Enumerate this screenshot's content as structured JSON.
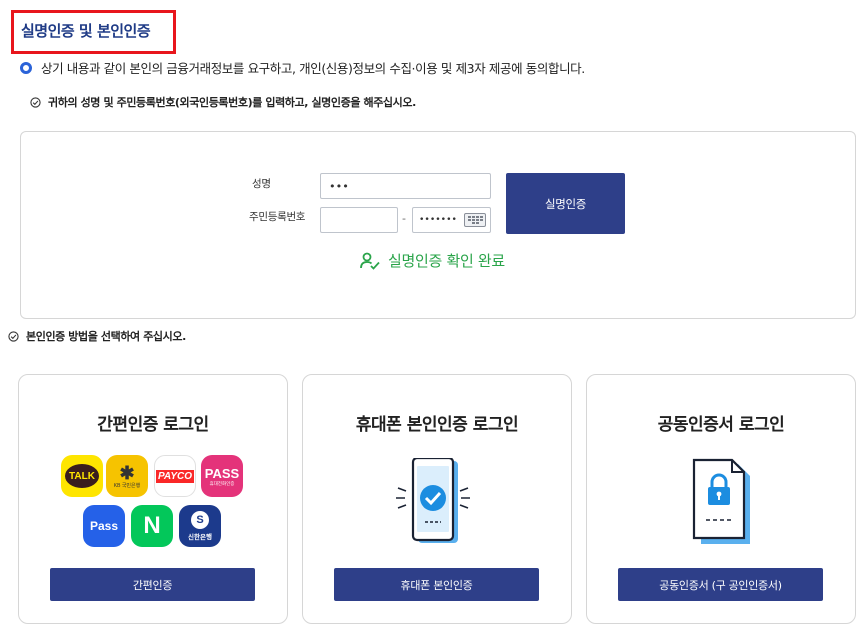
{
  "header": {
    "title": "실명인증 및 본인인증",
    "agreement": "상기 내용과 같이 본인의 금융거래정보를 요구하고, 개인(신용)정보의 수집·이용 및 제3자 제공에 동의합니다."
  },
  "identity_form": {
    "instruction": "귀하의 성명 및 주민등록번호(외국인등록번호)를 입력하고, 실명인증을 해주십시오.",
    "name_label": "성명",
    "name_value": "•••",
    "rrn_label": "주민등록번호",
    "rrn_first_value": "",
    "rrn_separator": "-",
    "rrn_second_value": "•••••••",
    "verify_button": "실명인증",
    "status_text": "실명인증 확인 완료"
  },
  "auth_section": {
    "instruction": "본인인증 방법을 선택하여 주십시오.",
    "cards": [
      {
        "title": "간편인증 로그인",
        "button": "간편인증"
      },
      {
        "title": "휴대폰 본인인증 로그인",
        "button": "휴대폰 본인인증"
      },
      {
        "title": "공동인증서 로그인",
        "button": "공동인증서 (구 공인인증서)"
      }
    ],
    "apps": {
      "kakao": "TALK",
      "kb": "KB 국민은행",
      "payco": "PAYCO",
      "pass_big": "PASS",
      "pass_small": "휴대전화인증",
      "pass2": "Pass",
      "naver": "N",
      "shinhan_logo": "S",
      "shinhan": "신한은행"
    }
  },
  "colors": {
    "primary_button": "#2e3f89",
    "title": "#1f3b86",
    "highlight_border": "#e8161c",
    "success": "#2aa44a"
  }
}
